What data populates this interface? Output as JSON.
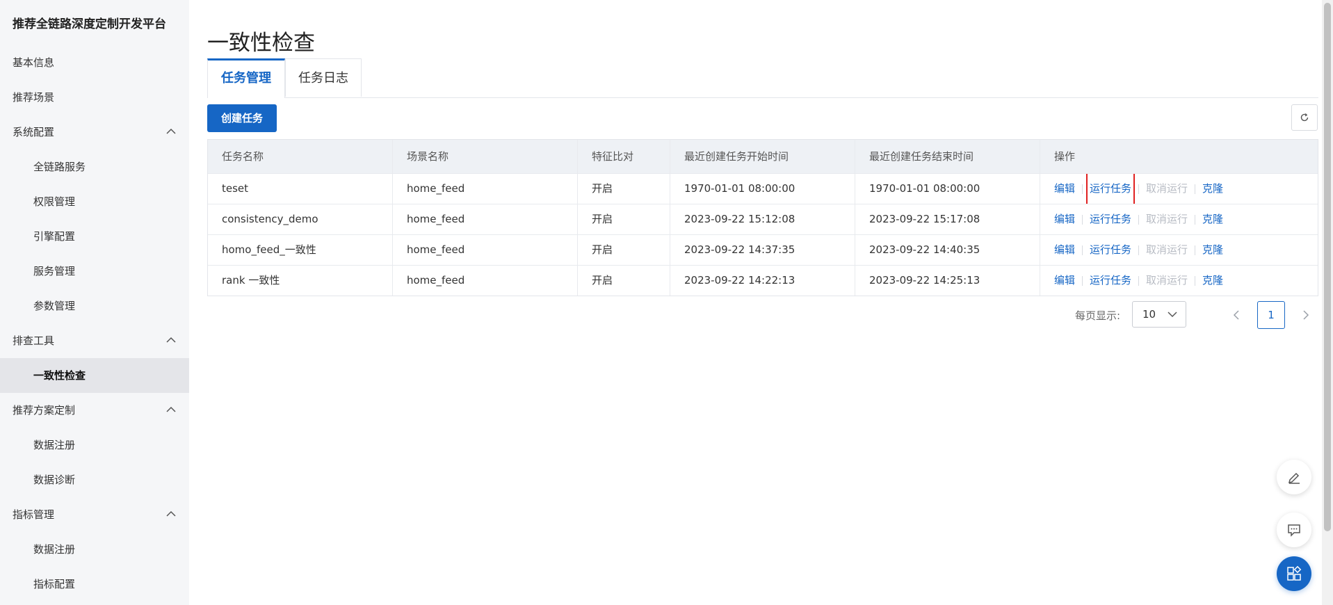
{
  "app_title": "推荐全链路深度定制开发平台",
  "sidebar": {
    "items": [
      {
        "label": "基本信息",
        "level": 0
      },
      {
        "label": "推荐场景",
        "level": 0
      },
      {
        "label": "系统配置",
        "level": 0,
        "expanded": true
      },
      {
        "label": "全链路服务",
        "level": 1
      },
      {
        "label": "权限管理",
        "level": 1
      },
      {
        "label": "引擎配置",
        "level": 1
      },
      {
        "label": "服务管理",
        "level": 1
      },
      {
        "label": "参数管理",
        "level": 1
      },
      {
        "label": "排查工具",
        "level": 0,
        "expanded": true
      },
      {
        "label": "一致性检查",
        "level": 1,
        "active": true
      },
      {
        "label": "推荐方案定制",
        "level": 0,
        "expanded": true
      },
      {
        "label": "数据注册",
        "level": 1
      },
      {
        "label": "数据诊断",
        "level": 1
      },
      {
        "label": "指标管理",
        "level": 0,
        "expanded": true
      },
      {
        "label": "数据注册",
        "level": 1
      },
      {
        "label": "指标配置",
        "level": 1
      }
    ]
  },
  "page": {
    "title": "一致性检查",
    "tabs": [
      {
        "label": "任务管理",
        "active": true
      },
      {
        "label": "任务日志",
        "active": false
      }
    ],
    "create_button": "创建任务",
    "refresh_icon": "refresh-icon"
  },
  "table": {
    "columns": [
      "任务名称",
      "场景名称",
      "特征比对",
      "最近创建任务开始时间",
      "最近创建任务结束时间",
      "操作"
    ],
    "rows": [
      {
        "name": "teset",
        "scene": "home_feed",
        "compare": "开启",
        "start": "1970-01-01 08:00:00",
        "end": "1970-01-01 08:00:00"
      },
      {
        "name": "consistency_demo",
        "scene": "home_feed",
        "compare": "开启",
        "start": "2023-09-22 15:12:08",
        "end": "2023-09-22 15:17:08"
      },
      {
        "name": "homo_feed_一致性",
        "scene": "home_feed",
        "compare": "开启",
        "start": "2023-09-22 14:37:35",
        "end": "2023-09-22 14:40:35"
      },
      {
        "name": "rank 一致性",
        "scene": "home_feed",
        "compare": "开启",
        "start": "2023-09-22 14:22:13",
        "end": "2023-09-22 14:25:13"
      }
    ],
    "actions": {
      "edit": "编辑",
      "run": "运行任务",
      "cancel": "取消运行",
      "clone": "克隆"
    },
    "highlighted_action": {
      "row": 0,
      "action": "run",
      "color": "#e02020"
    }
  },
  "pagination": {
    "page_size_label": "每页显示:",
    "page_size": "10",
    "current_page": "1"
  },
  "colors": {
    "primary": "#1666c5",
    "sidebar_bg": "#f5f6f8",
    "disabled": "#b8bcc4"
  }
}
